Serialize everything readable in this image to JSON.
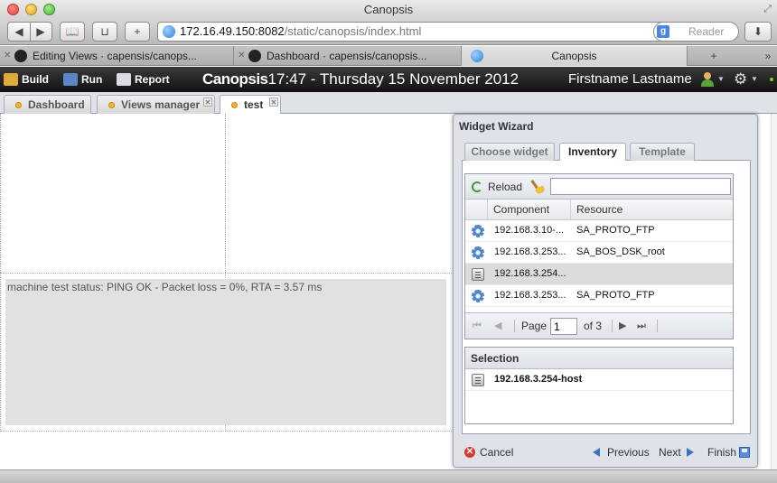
{
  "browser": {
    "window_title": "Canopsis",
    "url_host": "172.16.49.150:8082",
    "url_path": "/static/canopsis/index.html",
    "reader_label": "Reader",
    "search_engine_badge": "g",
    "tabs": [
      {
        "label": "Editing Views · capensis/canops..."
      },
      {
        "label": "Dashboard · capensis/canopsis..."
      },
      {
        "label": "Canopsis"
      }
    ],
    "newtab_label": "+"
  },
  "app": {
    "menu": [
      {
        "label": "Build"
      },
      {
        "label": "Run"
      },
      {
        "label": "Report"
      }
    ],
    "brand": "Canopsis",
    "datetime": "17:47 - Thursday 15 November 2012",
    "user": "Firstname Lastname",
    "tabs": [
      {
        "label": "Dashboard"
      },
      {
        "label": "Views manager"
      },
      {
        "label": "test"
      }
    ]
  },
  "content": {
    "status_text": "machine test status: PING OK - Packet loss = 0%, RTA = 3.57 ms"
  },
  "wizard": {
    "title": "Widget Wizard",
    "tabs": [
      {
        "label": "Choose widget"
      },
      {
        "label": "Inventory"
      },
      {
        "label": "Template"
      }
    ],
    "active_tab": "Inventory",
    "reload_label": "Reload",
    "search_value": "",
    "columns": {
      "component": "Component",
      "resource": "Resource"
    },
    "rows": [
      {
        "icon": "gear-icon",
        "component": "192.168.3.10-...",
        "resource": "SA_PROTO_FTP"
      },
      {
        "icon": "gear-icon",
        "component": "192.168.3.253...",
        "resource": "SA_BOS_DSK_root"
      },
      {
        "icon": "server-icon",
        "component": "192.168.3.254...",
        "resource": ""
      },
      {
        "icon": "gear-icon",
        "component": "192.168.3.253...",
        "resource": "SA_PROTO_FTP"
      }
    ],
    "pager": {
      "page_label": "Page",
      "page_value": "1",
      "of_label": "of 3"
    },
    "selection": {
      "title": "Selection",
      "items": [
        {
          "label": "192.168.3.254-host"
        }
      ]
    },
    "footer": {
      "cancel": "Cancel",
      "previous": "Previous",
      "next": "Next",
      "finish": "Finish"
    }
  },
  "colors": {
    "appbar": "#1a1a1a",
    "wizard_bg": "#dfe3e9",
    "selected_row": "#dcdcdc",
    "accent_blue": "#3b70c5"
  }
}
